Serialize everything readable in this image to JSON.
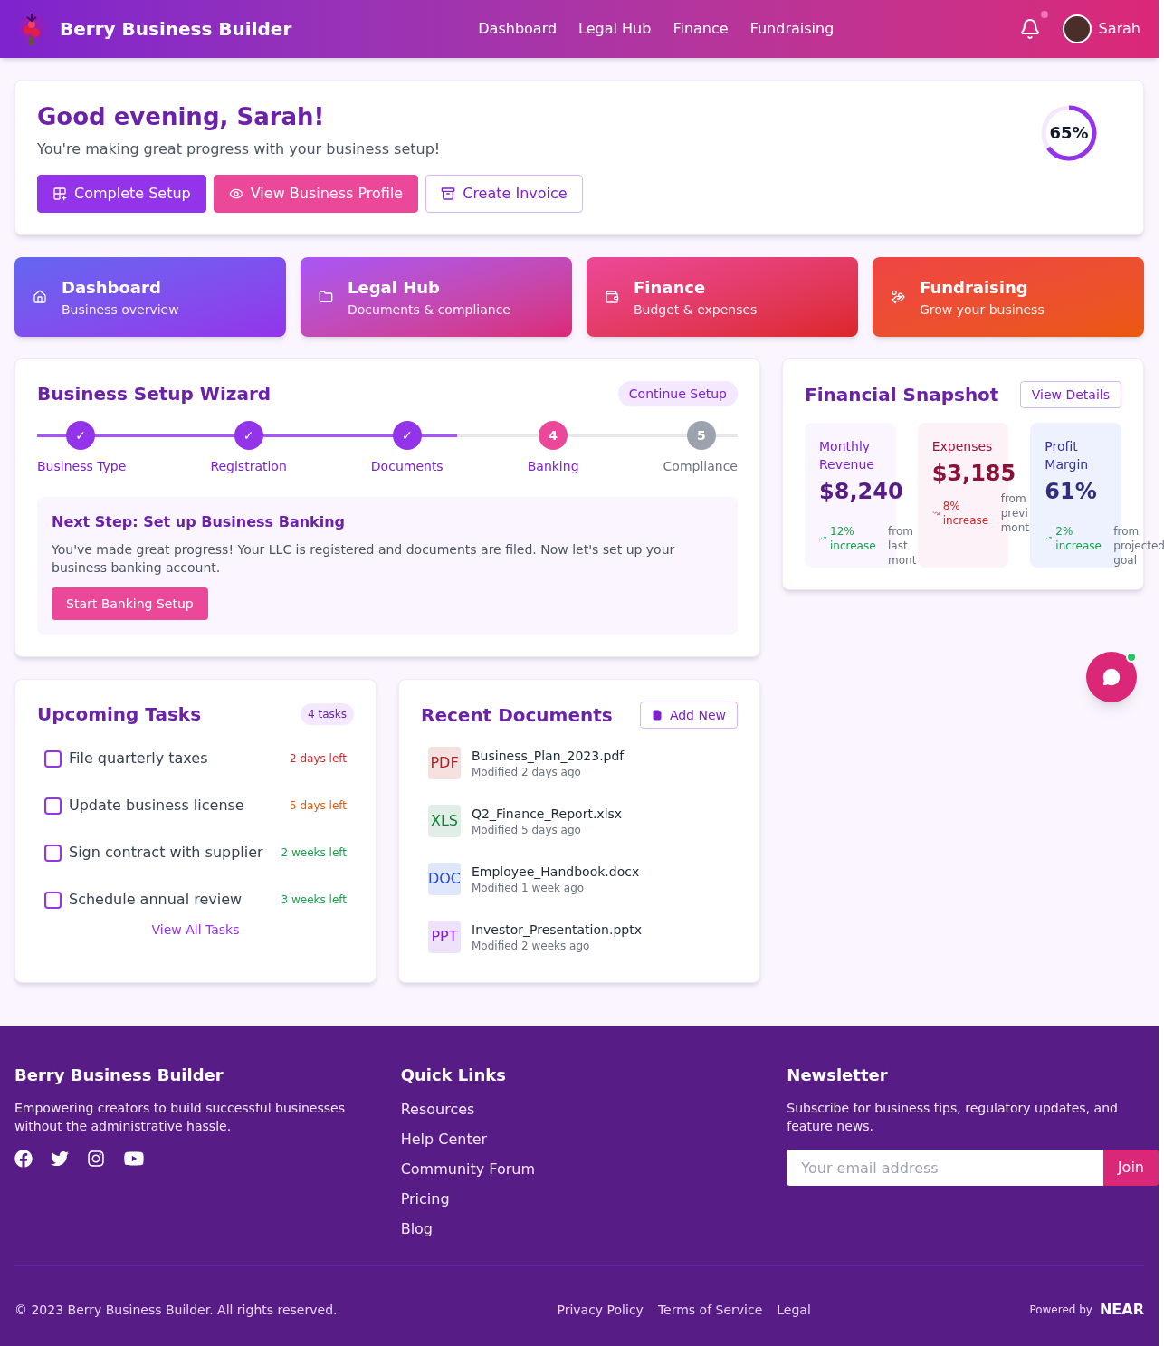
{
  "header": {
    "brand": "Berry Business Builder",
    "nav": [
      "Dashboard",
      "Legal Hub",
      "Finance",
      "Fundraising"
    ],
    "notification": true,
    "user": "Sarah"
  },
  "welcome": {
    "title": "Good evening, Sarah!",
    "subtitle": "You're making great progress with your business setup!",
    "progress": {
      "label": "65%",
      "level": 0.65
    },
    "buttons": [
      {
        "label": "Complete Setup",
        "kind": "primary"
      },
      {
        "label": "View Business Profile",
        "kind": "accent"
      },
      {
        "label": "Create Invoice",
        "kind": "outline"
      }
    ]
  },
  "quick_cards": [
    {
      "title": "Dashboard",
      "subtitle": "Business overview"
    },
    {
      "title": "Legal Hub",
      "subtitle": "Documents & compliance"
    },
    {
      "title": "Finance",
      "subtitle": "Budget & expenses"
    },
    {
      "title": "Fundraising",
      "subtitle": "Grow your business"
    }
  ],
  "wizard": {
    "title": "Business Setup Wizard",
    "action": "Continue Setup",
    "level": 0.6,
    "steps": [
      {
        "marker": "✓",
        "label": "Business Type",
        "done": true,
        "current": false
      },
      {
        "marker": "✓",
        "label": "Registration",
        "done": true,
        "current": false
      },
      {
        "marker": "✓",
        "label": "Documents",
        "done": true,
        "current": false
      },
      {
        "marker": "4",
        "label": "Banking",
        "done": false,
        "current": true
      },
      {
        "marker": "5",
        "label": "Compliance",
        "done": false,
        "current": false
      }
    ],
    "next_step": {
      "title": "Next Step: Set up Business Banking",
      "text": "You've made great progress! Your LLC is registered and documents are filed. Now let's set up your business banking account.",
      "button": "Start Banking Setup"
    }
  },
  "snapshot": {
    "title": "Financial Snapshot",
    "action": "View Details",
    "metrics": [
      {
        "label": "Monthly Revenue",
        "value": "$8,240",
        "change": "12% increase",
        "down": false,
        "note": "from last mont"
      },
      {
        "label": "Expenses",
        "value": "$3,185",
        "change": "8% increase",
        "down": true,
        "note": "from previ mont"
      },
      {
        "label": "Profit Margin",
        "value": "61%",
        "change": "2% increase",
        "down": false,
        "note": "from projected goal"
      }
    ]
  },
  "tasks": {
    "title": "Upcoming Tasks",
    "count": "4 tasks",
    "link": "View All Tasks",
    "items": [
      {
        "label": "File quarterly taxes",
        "checked": false,
        "due": "2 days left",
        "color": "#dc2626"
      },
      {
        "label": "Update business license",
        "checked": false,
        "due": "5 days left",
        "color": "#ea580c"
      },
      {
        "label": "Sign contract with supplier",
        "checked": false,
        "due": "2 weeks left",
        "color": "#16a34a"
      },
      {
        "label": "Schedule annual review",
        "checked": false,
        "due": "3 weeks left",
        "color": "#16a34a"
      }
    ]
  },
  "documents": {
    "title": "Recent Documents",
    "action": "Add New",
    "files": [
      {
        "type": "PDF",
        "name": "Business_Plan_2023.pdf",
        "modified": "Modified 2 days ago",
        "color": "#b91c1c"
      },
      {
        "type": "XLS",
        "name": "Q2_Finance_Report.xlsx",
        "modified": "Modified 5 days ago",
        "color": "#15803d"
      },
      {
        "type": "DOC",
        "name": "Employee_Handbook.docx",
        "modified": "Modified 1 week ago",
        "color": "#1d4ed8"
      },
      {
        "type": "PPT",
        "name": "Investor_Presentation.pptx",
        "modified": "Modified 2 weeks ago",
        "color": "#7e22ce"
      }
    ]
  },
  "chat": {
    "online": true
  },
  "footer": {
    "brand": "Berry Business Builder",
    "about": "Empowering creators to build successful businesses without the administrative hassle.",
    "links_title": "Quick Links",
    "links": [
      "Resources",
      "Help Center",
      "Community Forum",
      "Pricing",
      "Blog"
    ],
    "newsletter_title": "Newsletter",
    "newsletter_text": "Subscribe for business tips, regulatory updates, and feature news.",
    "placeholder": "Your email address",
    "join": "Join",
    "copyright": "© 2023 Berry Business Builder. All rights reserved.",
    "legal_links": [
      "Privacy Policy",
      "Terms of Service",
      "Legal"
    ],
    "powered_by": "Powered by",
    "near": "NEAR"
  }
}
